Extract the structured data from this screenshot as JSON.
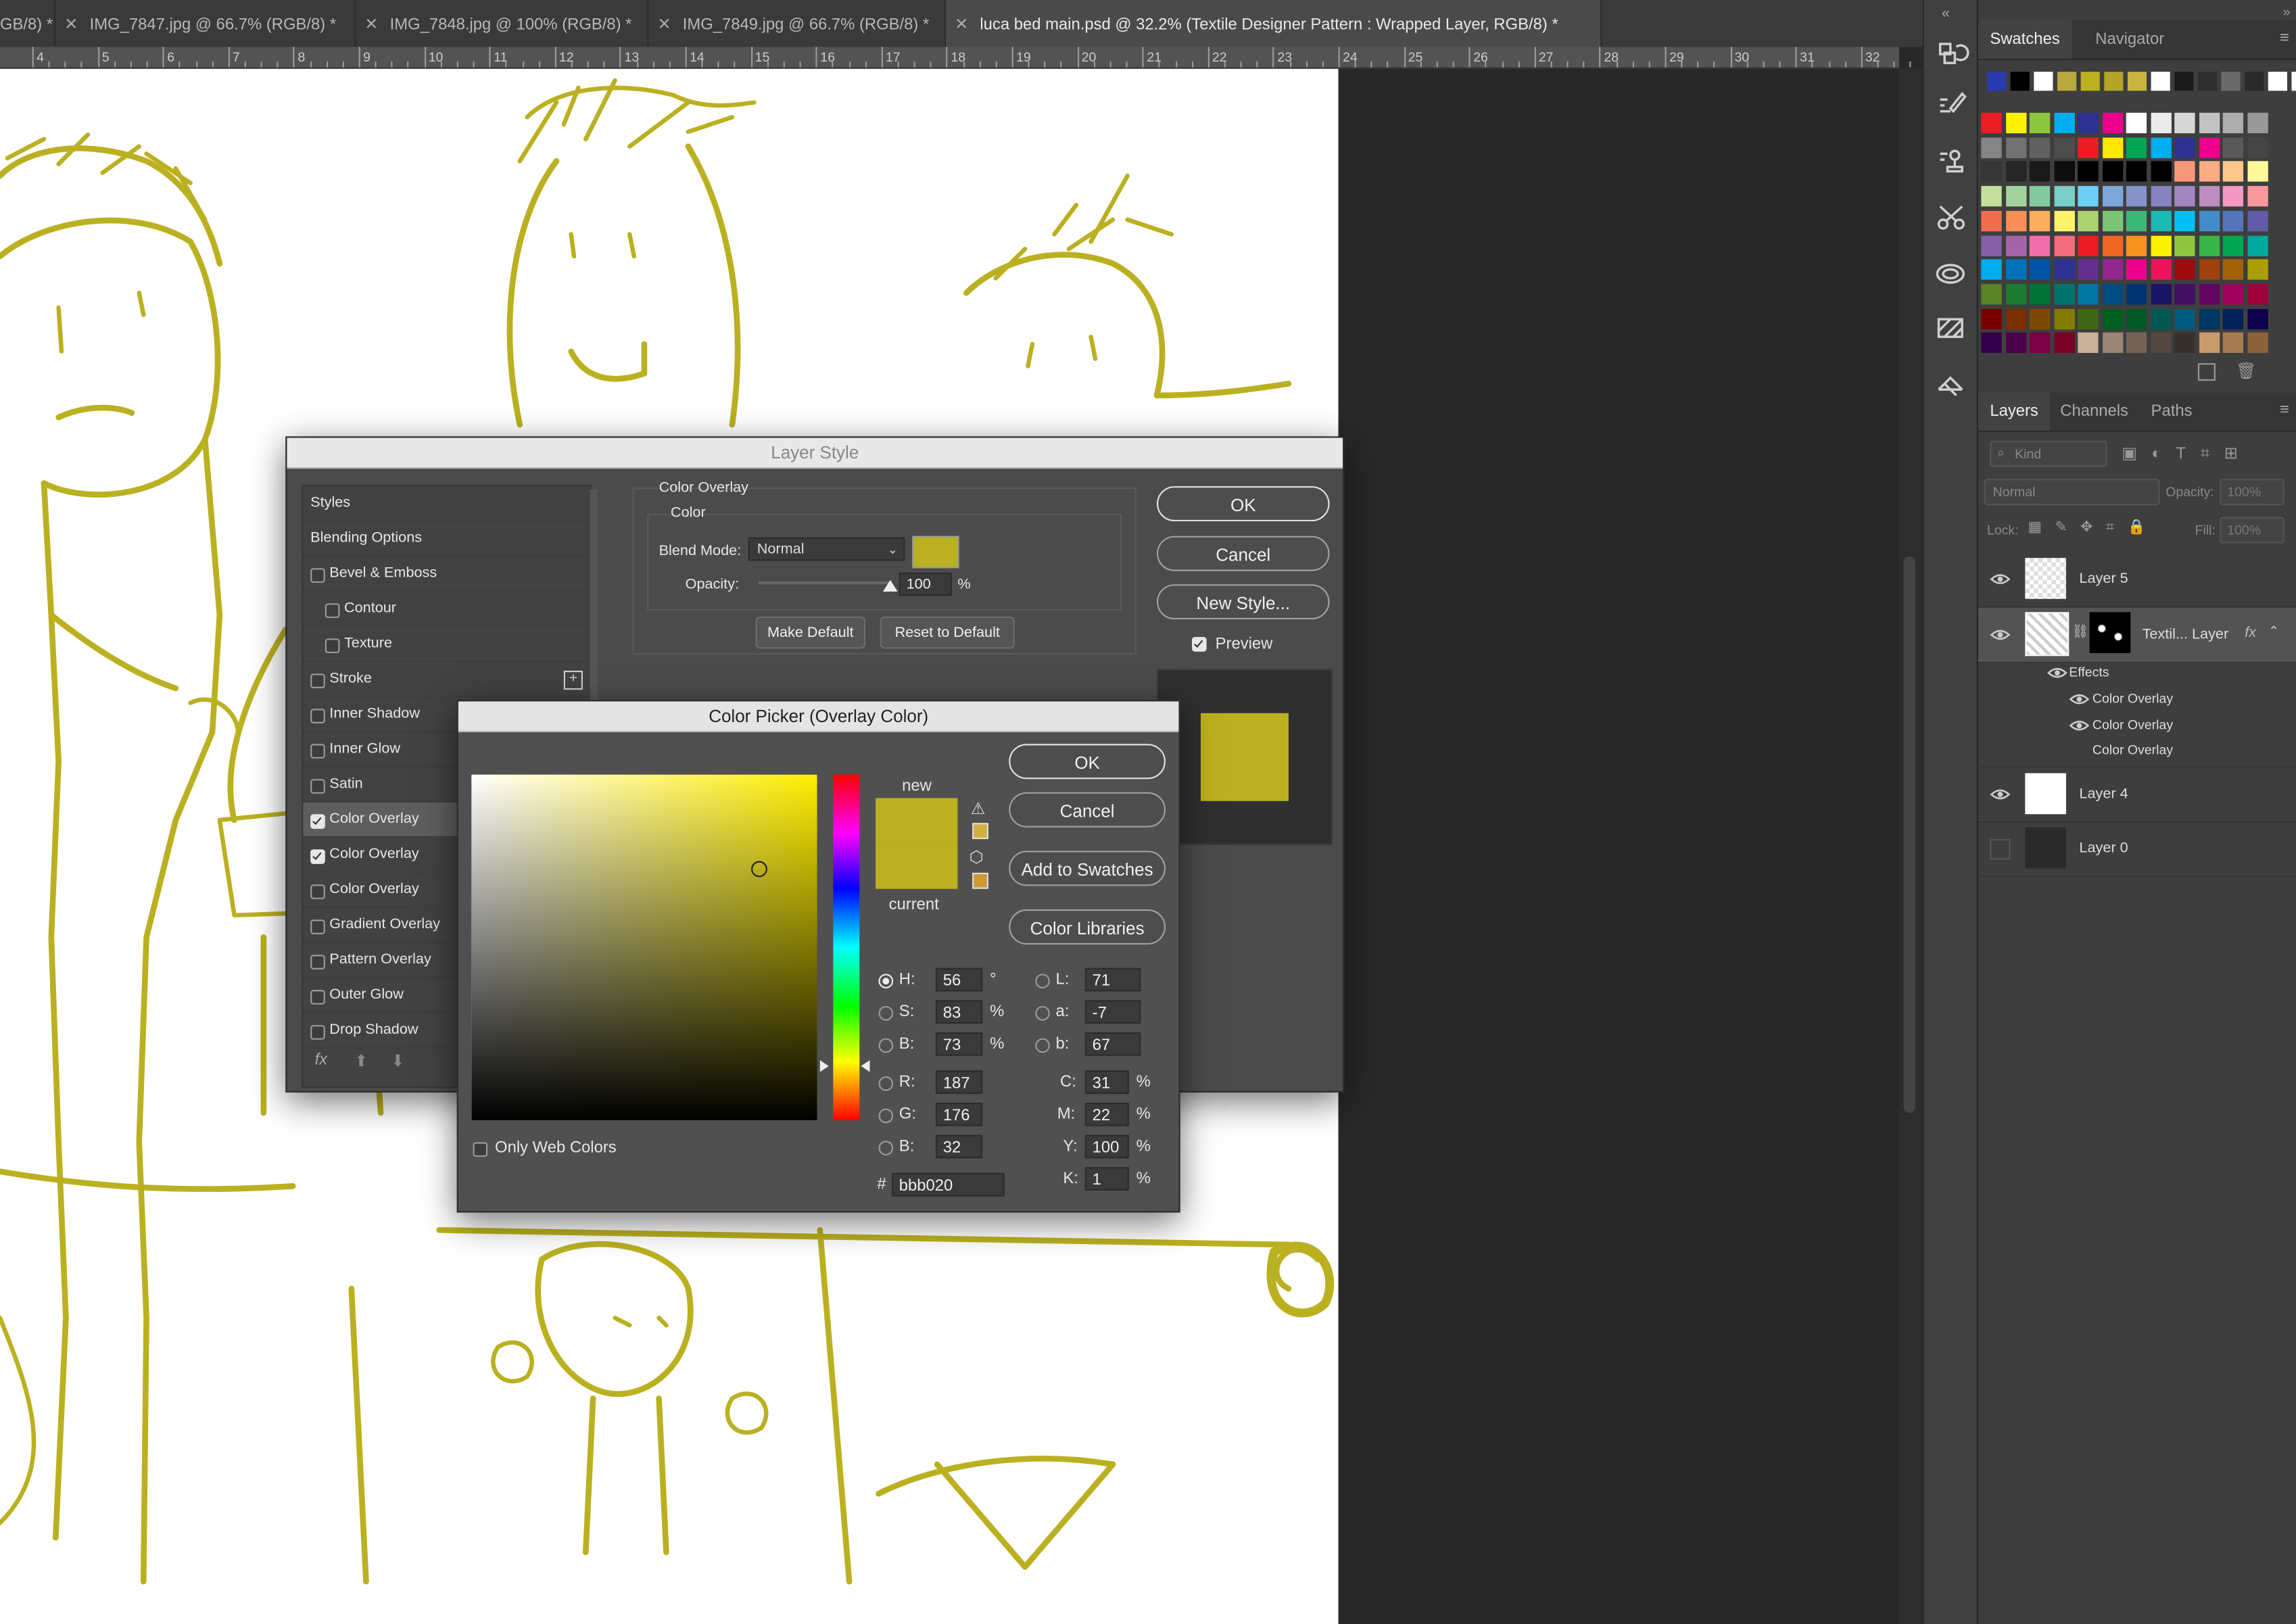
{
  "tabs": [
    {
      "label": "GB/8) *",
      "active": false
    },
    {
      "label": "IMG_7847.jpg @ 66.7% (RGB/8) *",
      "active": false
    },
    {
      "label": "IMG_7848.jpg @ 100% (RGB/8) *",
      "active": false
    },
    {
      "label": "IMG_7849.jpg @ 66.7% (RGB/8) *",
      "active": false
    },
    {
      "label": "luca bed main.psd @ 32.2% (Textile Designer Pattern : Wrapped Layer, RGB/8) *",
      "active": true
    }
  ],
  "ruler": {
    "labels": [
      "4",
      "5",
      "6",
      "7",
      "8",
      "9",
      "10",
      "11",
      "12",
      "13",
      "14",
      "15",
      "16",
      "17",
      "18",
      "19",
      "20",
      "21",
      "22",
      "23",
      "24",
      "25",
      "26",
      "27",
      "28",
      "29",
      "30",
      "31",
      "32"
    ]
  },
  "colors": {
    "drawing": "#bbb020",
    "panel": "#3e3e3e",
    "dialog": "#4b4b4b"
  },
  "swatches_panel": {
    "tabs": [
      "Swatches",
      "Navigator"
    ],
    "recent": [
      "#2a3ab0",
      "#000000",
      "#ffffff",
      "#b8a840",
      "#bbb020",
      "#b4a428",
      "#c8b440",
      "#ffffff",
      "#1a1a1a",
      "#2e2e2e",
      "#6a6a6a",
      "#2a2a2a",
      "#ffffff",
      "#ffffff"
    ],
    "grid": [
      [
        "#ee1c24",
        "#fff200",
        "#8dc73f",
        "#00aeef",
        "#2e3192",
        "#ec008c",
        "#ffffff",
        "#ebebeb",
        "#d7d7d7",
        "#c2c2c2",
        "#adadad",
        "#999999"
      ],
      [
        "#858585",
        "#727272",
        "#606060",
        "#4d4d4d",
        "#ed1c24",
        "#ffe800",
        "#00a651",
        "#00aeef",
        "#2e3192",
        "#ec008c",
        "#595959",
        "#454545"
      ],
      [
        "#363636",
        "#262626",
        "#1a1a1a",
        "#0d0d0d",
        "#000000",
        "#000000",
        "#000000",
        "#000000",
        "#f7977a",
        "#f9ad81",
        "#fdc68a",
        "#fff799"
      ],
      [
        "#c4df9b",
        "#a3d39c",
        "#82ca9d",
        "#7bcdc8",
        "#6ecff6",
        "#7ea7d8",
        "#8493ca",
        "#8882be",
        "#a187be",
        "#bc8dbf",
        "#f49ac2",
        "#f6989d"
      ],
      [
        "#f26c4f",
        "#f68e55",
        "#fbaf5c",
        "#fff467",
        "#acd372",
        "#7cc576",
        "#3bb878",
        "#1abbb4",
        "#00bff3",
        "#438ccb",
        "#5574b9",
        "#605ca8"
      ],
      [
        "#8560a8",
        "#a763a8",
        "#f06eaa",
        "#f26d7d",
        "#ed1c24",
        "#f26522",
        "#f7941d",
        "#fff200",
        "#8dc73f",
        "#39b54a",
        "#00a651",
        "#00a99d"
      ],
      [
        "#00aeef",
        "#0072bc",
        "#0054a6",
        "#2e3192",
        "#662d91",
        "#92278f",
        "#ec008c",
        "#ed145b",
        "#9e0b0f",
        "#a0410d",
        "#a3620a",
        "#aba000"
      ],
      [
        "#598527",
        "#1a7b30",
        "#007236",
        "#00746b",
        "#0076a3",
        "#004a80",
        "#003471",
        "#1b1464",
        "#440e62",
        "#630460",
        "#9e005d",
        "#9e0039"
      ],
      [
        "#790000",
        "#7b2e00",
        "#7d4900",
        "#827b00",
        "#406618",
        "#005e20",
        "#005826",
        "#005952",
        "#005b7f",
        "#003663",
        "#002157",
        "#0d004c"
      ],
      [
        "#32004b",
        "#4b0049",
        "#7b0046",
        "#7a0026",
        "#c7b299",
        "#998675",
        "#736357",
        "#534741",
        "#37302d",
        "#c69c6d",
        "#a67c52",
        "#8c6239"
      ]
    ]
  },
  "layers_panel": {
    "tabs": [
      "Layers",
      "Channels",
      "Paths"
    ],
    "filter_placeholder": "Kind",
    "blend_mode": "Normal",
    "opacity_label": "Opacity:",
    "opacity_value": "100%",
    "lock_label": "Lock:",
    "fill_label": "Fill:",
    "fill_value": "100%",
    "layers": {
      "layer5": "Layer 5",
      "textile": "Textil... Layer",
      "fx": "fx",
      "effects": "Effects",
      "effect1": "Color Overlay",
      "effect2": "Color Overlay",
      "effect3": "Color Overlay",
      "layer4": "Layer 4",
      "layer0": "Layer 0"
    }
  },
  "layer_style": {
    "title": "Layer Style",
    "styles_header": "Styles",
    "items": [
      {
        "label": "Blending Options",
        "checkbox": false,
        "checked": false,
        "indent": false
      },
      {
        "label": "Bevel & Emboss",
        "checkbox": true,
        "checked": false,
        "indent": false
      },
      {
        "label": "Contour",
        "checkbox": true,
        "checked": false,
        "indent": true
      },
      {
        "label": "Texture",
        "checkbox": true,
        "checked": false,
        "indent": true
      },
      {
        "label": "Stroke",
        "checkbox": true,
        "checked": false,
        "indent": false,
        "plus": true
      },
      {
        "label": "Inner Shadow",
        "checkbox": true,
        "checked": false,
        "indent": false
      },
      {
        "label": "Inner Glow",
        "checkbox": true,
        "checked": false,
        "indent": false
      },
      {
        "label": "Satin",
        "checkbox": true,
        "checked": false,
        "indent": false
      },
      {
        "label": "Color Overlay",
        "checkbox": true,
        "checked": true,
        "indent": false,
        "selected": true
      },
      {
        "label": "Color Overlay",
        "checkbox": true,
        "checked": true,
        "indent": false
      },
      {
        "label": "Color Overlay",
        "checkbox": true,
        "checked": false,
        "indent": false
      },
      {
        "label": "Gradient Overlay",
        "checkbox": true,
        "checked": false,
        "indent": false
      },
      {
        "label": "Pattern Overlay",
        "checkbox": true,
        "checked": false,
        "indent": false
      },
      {
        "label": "Outer Glow",
        "checkbox": true,
        "checked": false,
        "indent": false
      },
      {
        "label": "Drop Shadow",
        "checkbox": true,
        "checked": false,
        "indent": false
      }
    ],
    "section_title": "Color Overlay",
    "subsection": "Color",
    "blend_mode_label": "Blend Mode:",
    "blend_mode_value": "Normal",
    "overlay_color": "#bbb020",
    "opacity_label": "Opacity:",
    "opacity_value": "100",
    "opacity_unit": "%",
    "opacity_level": 1.0,
    "make_default": "Make Default",
    "reset_default": "Reset to Default",
    "ok": "OK",
    "cancel": "Cancel",
    "new_style": "New Style...",
    "preview_label": "Preview",
    "preview_checked": true,
    "fx_label": "fx"
  },
  "color_picker": {
    "title": "Color Picker (Overlay Color)",
    "ok": "OK",
    "cancel": "Cancel",
    "add_to_swatches": "Add to Swatches",
    "color_libraries": "Color Libraries",
    "new_label": "new",
    "current_label": "current",
    "new_color": "#bbb020",
    "current_color": "#bbb020",
    "hue_deg": 56,
    "fields": {
      "H": {
        "label": "H:",
        "value": "56",
        "unit": "°"
      },
      "S": {
        "label": "S:",
        "value": "83",
        "unit": "%"
      },
      "Bv": {
        "label": "B:",
        "value": "73",
        "unit": "%"
      },
      "R": {
        "label": "R:",
        "value": "187"
      },
      "G": {
        "label": "G:",
        "value": "176"
      },
      "Bb": {
        "label": "B:",
        "value": "32"
      },
      "L": {
        "label": "L:",
        "value": "71"
      },
      "a": {
        "label": "a:",
        "value": "-7"
      },
      "b": {
        "label": "b:",
        "value": "67"
      },
      "C": {
        "label": "C:",
        "value": "31",
        "unit": "%"
      },
      "M": {
        "label": "M:",
        "value": "22",
        "unit": "%"
      },
      "Y": {
        "label": "Y:",
        "value": "100",
        "unit": "%"
      },
      "K": {
        "label": "K:",
        "value": "1",
        "unit": "%"
      }
    },
    "hex_label": "#",
    "hex_value": "bbb020",
    "only_web_colors": "Only Web Colors",
    "only_web_checked": false
  }
}
